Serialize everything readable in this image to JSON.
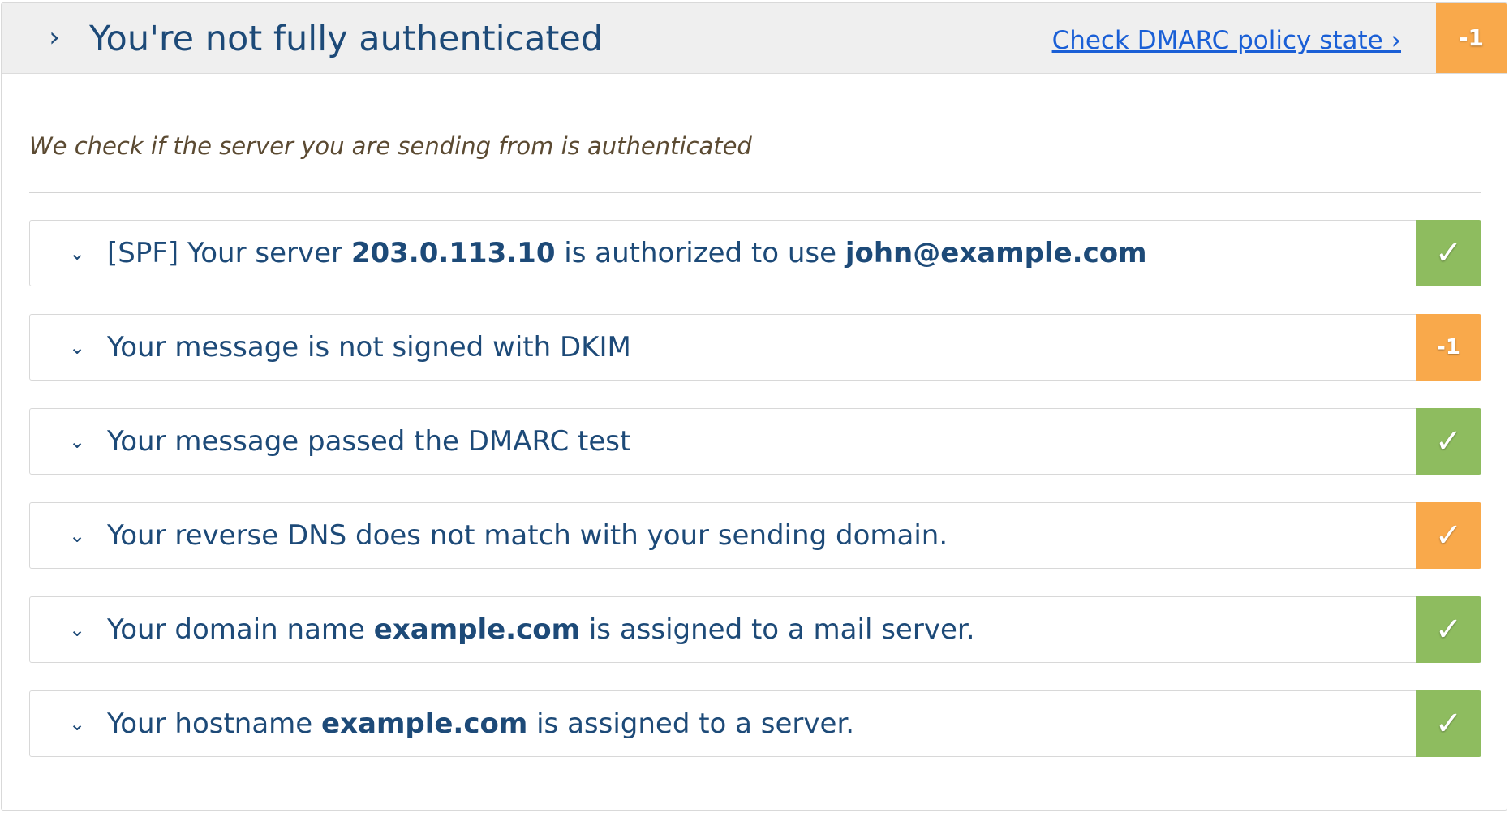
{
  "header": {
    "title": "You're not fully authenticated",
    "link_label": "Check DMARC policy state ›",
    "score": "-1",
    "score_color": "#f9a94b",
    "chevron_icon": "chevron-right-icon"
  },
  "intro": "We check if the server you are sending from is authenticated",
  "colors": {
    "pass": "#8ebc5f",
    "warn": "#f9a94b",
    "text": "#1d4a78",
    "link": "#1a5fd6"
  },
  "checks": [
    {
      "prefix": "[SPF] Your server ",
      "bold1": "203.0.113.10",
      "middle": " is authorized to use ",
      "bold2": "john@example.com",
      "suffix": "",
      "status": "✓",
      "status_icon": "check-icon",
      "status_color": "#8ebc5f"
    },
    {
      "prefix": "Your message is not signed with DKIM",
      "bold1": "",
      "middle": "",
      "bold2": "",
      "suffix": "",
      "status": "-1",
      "status_icon": "score-badge",
      "status_color": "#f9a94b"
    },
    {
      "prefix": "Your message passed the DMARC test",
      "bold1": "",
      "middle": "",
      "bold2": "",
      "suffix": "",
      "status": "✓",
      "status_icon": "check-icon",
      "status_color": "#8ebc5f"
    },
    {
      "prefix": "Your reverse DNS does not match with your sending domain.",
      "bold1": "",
      "middle": "",
      "bold2": "",
      "suffix": "",
      "status": "✓",
      "status_icon": "check-icon",
      "status_color": "#f9a94b"
    },
    {
      "prefix": "Your domain name ",
      "bold1": "example.com",
      "middle": " is assigned to a mail server.",
      "bold2": "",
      "suffix": "",
      "status": "✓",
      "status_icon": "check-icon",
      "status_color": "#8ebc5f"
    },
    {
      "prefix": "Your hostname ",
      "bold1": "example.com",
      "middle": " is assigned to a server.",
      "bold2": "",
      "suffix": "",
      "status": "✓",
      "status_icon": "check-icon",
      "status_color": "#8ebc5f"
    }
  ]
}
